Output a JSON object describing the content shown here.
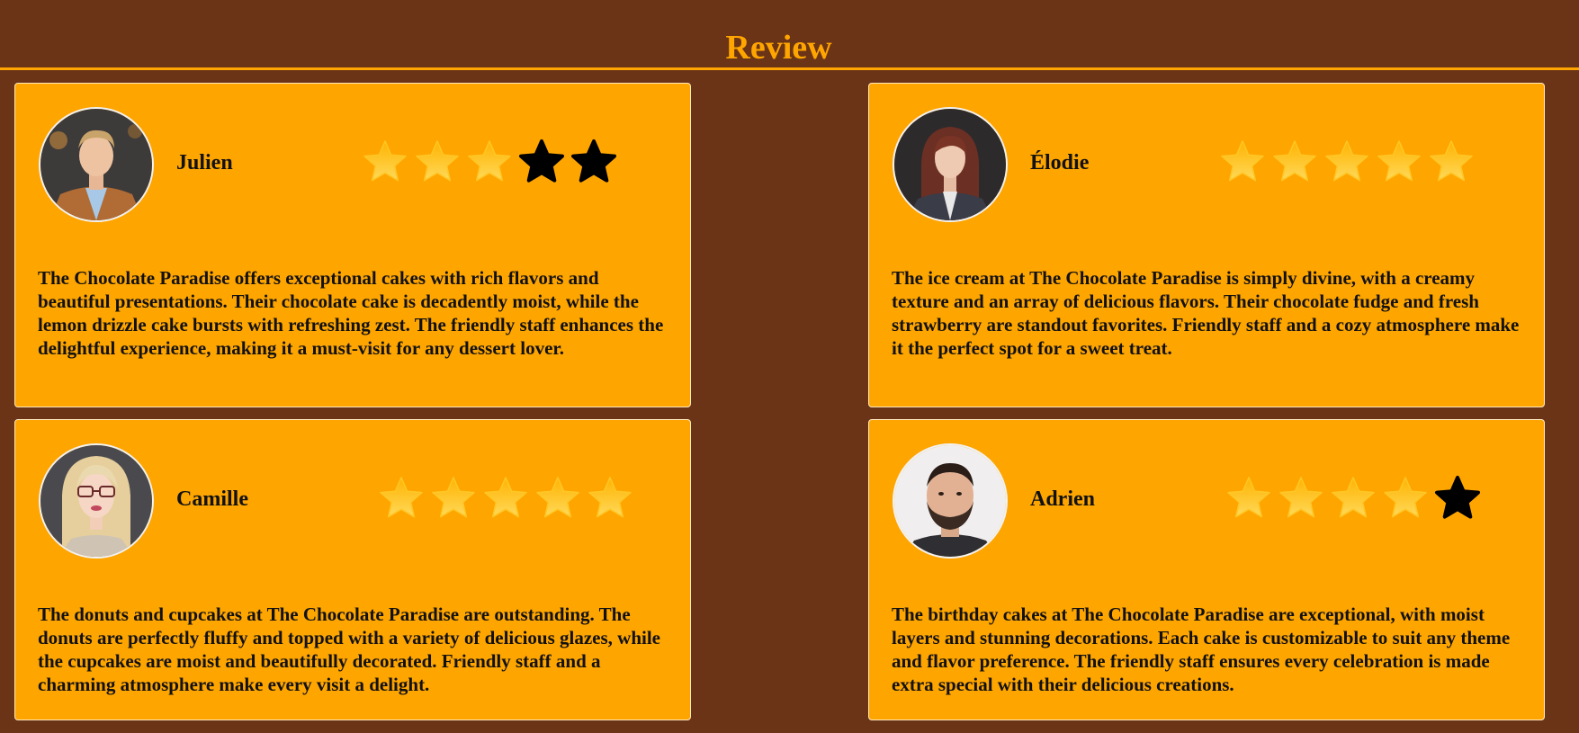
{
  "header": {
    "title": "Review"
  },
  "colors": {
    "background": "#6b3416",
    "card": "#ffa500",
    "accent": "#ffa500",
    "star_filled": "#ffc726",
    "star_empty": "#000000"
  },
  "reviews": [
    {
      "name": "Julien",
      "rating": 3,
      "max_rating": 5,
      "avatar": "man-in-tan-blazer",
      "text": "The Chocolate Paradise offers exceptional cakes with rich flavors and beautiful presentations. Their chocolate cake is decadently moist, while the lemon drizzle cake bursts with refreshing zest. The friendly staff enhances the delightful experience, making it a must-visit for any dessert lover."
    },
    {
      "name": "Élodie",
      "rating": 5,
      "max_rating": 5,
      "avatar": "woman-in-suit",
      "text": "The ice cream at The Chocolate Paradise is simply divine, with a creamy texture and an array of delicious flavors. Their chocolate fudge and fresh strawberry are standout favorites. Friendly staff and a cozy atmosphere make it the perfect spot for a sweet treat."
    },
    {
      "name": "Camille",
      "rating": 5,
      "max_rating": 5,
      "avatar": "blonde-woman-with-glasses",
      "text": "The donuts and cupcakes at The Chocolate Paradise are outstanding. The donuts are perfectly fluffy and topped with a variety of delicious glazes, while the cupcakes are moist and beautifully decorated. Friendly staff and a charming atmosphere make every visit a delight."
    },
    {
      "name": "Adrien",
      "rating": 4,
      "max_rating": 5,
      "avatar": "bearded-man",
      "text": "The birthday cakes at The Chocolate Paradise are exceptional, with moist layers and stunning decorations. Each cake is customizable to suit any theme and flavor preference. The friendly staff ensures every celebration is made extra special with their delicious creations."
    }
  ]
}
